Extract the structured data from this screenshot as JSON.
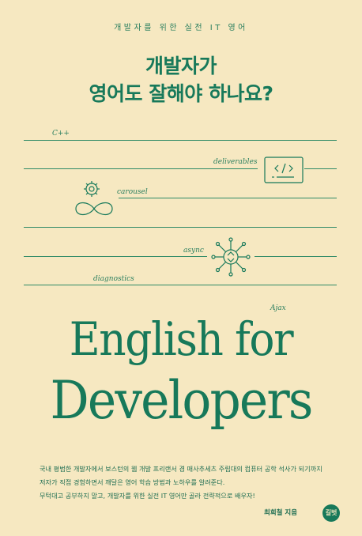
{
  "cover": {
    "series_label": "개발자를 위한 실전 IT 영어",
    "title_line1": "개발자가",
    "title_line2": "영어도 잘해야 하나요?",
    "keywords": {
      "cpp": "C++",
      "deliverables": "deliverables",
      "carousel": "carousel",
      "async": "async",
      "diagnostics": "diagnostics",
      "ajax": "Ajax"
    },
    "big_title_line1": "English for",
    "big_title_line2": "Developers",
    "description_lines": [
      "국내 평범한 개발자에서 보스턴의 웹 개발 프리랜서 겸 매사추세츠 주립대의 컴퓨터 공학 석사가 되기까지",
      "저자가 직접 경험하면서 깨달은 영어 학습 방법과 노하우를 알려준다.",
      "무턱대고 공부하지 말고, 개발자를 위한 실전 IT 영어만 골라 전략적으로 배우자!"
    ],
    "author": "최희철 지음",
    "publisher_logo": "길벗"
  },
  "colors": {
    "background": "#f6e8c1",
    "accent": "#17795a"
  },
  "icons": [
    "code-window-icon",
    "gear-infinity-icon",
    "network-hub-icon"
  ]
}
